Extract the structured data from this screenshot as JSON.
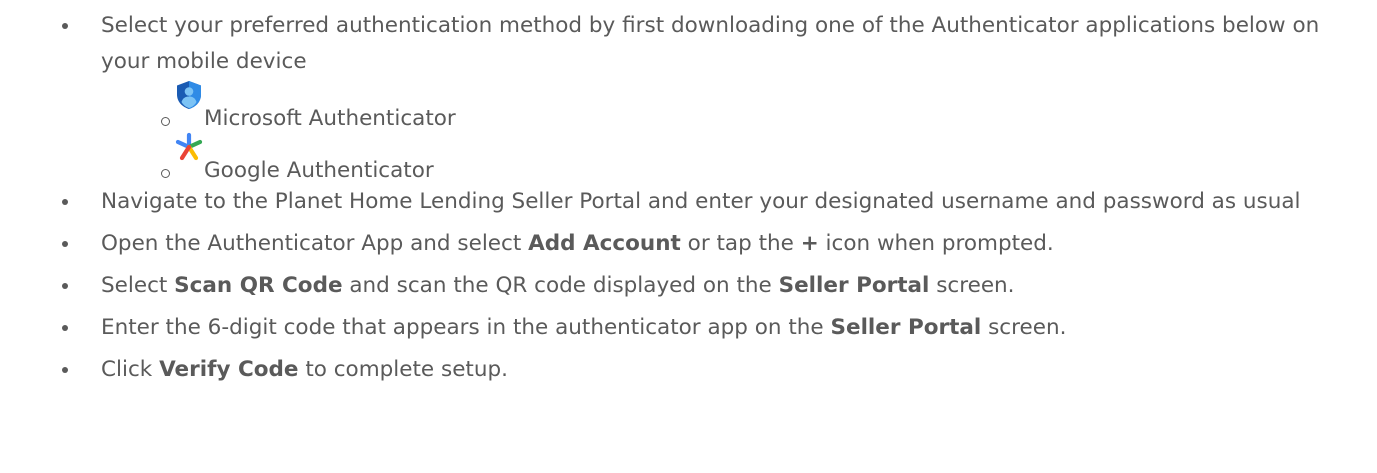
{
  "items": [
    {
      "text": "Select your preferred authentication method by first downloading one of the Authenticator applications below on your mobile device"
    },
    {
      "text": "Navigate to the Planet Home Lending Seller Portal and enter your designated username and password as usual"
    },
    {
      "pre": "Open the Authenticator App and select ",
      "b1": "Add Account",
      "mid": " or tap the ",
      "b2": "+",
      "post": " icon when prompted."
    },
    {
      "pre": "Select ",
      "b1": "Scan QR Code",
      "mid": " and scan the QR code displayed on the ",
      "b2": "Seller Portal",
      "post": " screen."
    },
    {
      "pre": "Enter the 6-digit code that appears in the authenticator app on the ",
      "b1": "Seller Portal",
      "post": " screen."
    },
    {
      "pre": "Click ",
      "b1": "Verify Code",
      "post": " to complete setup."
    }
  ],
  "apps": [
    {
      "label": "Microsoft Authenticator",
      "icon": "microsoft-authenticator-icon",
      "colors": [
        "#1a5bb3",
        "#2f8be6",
        "#7cc3f5"
      ]
    },
    {
      "label": "Google Authenticator",
      "icon": "google-authenticator-icon",
      "colors": [
        "#4285f4",
        "#34a853",
        "#fbbc04",
        "#ea4335"
      ]
    }
  ]
}
